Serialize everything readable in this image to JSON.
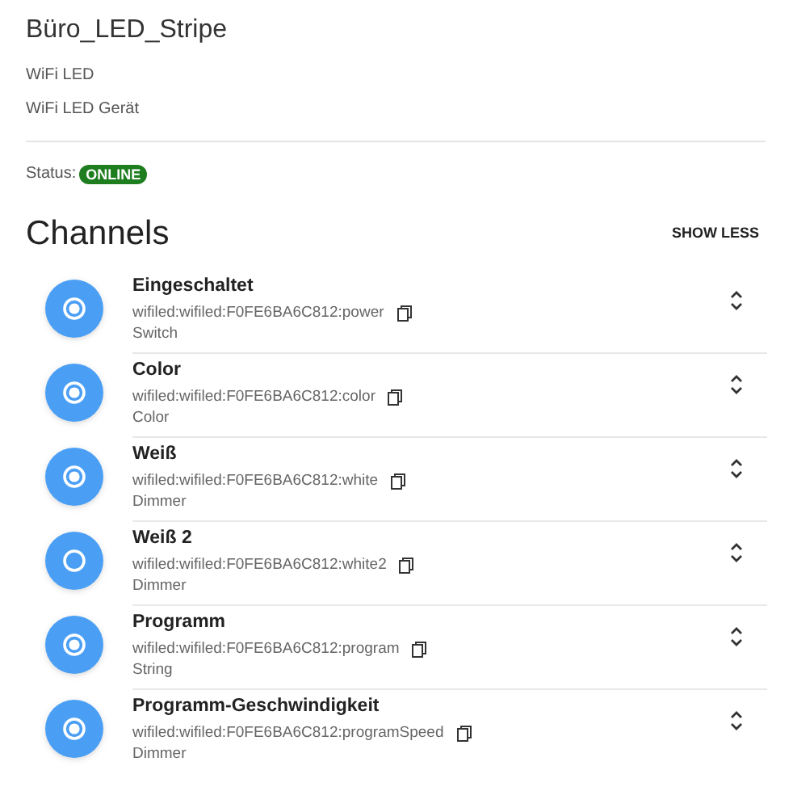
{
  "thing": {
    "title": "Büro_LED_Stripe",
    "type": "WiFi LED",
    "description": "WiFi LED Gerät"
  },
  "status": {
    "label": "Status:",
    "badge": "ONLINE"
  },
  "channels_section": {
    "title": "Channels",
    "toggle": "SHOW LESS"
  },
  "channels": [
    {
      "name": "Eingeschaltet",
      "uid": "wifiled:wifiled:F0FE6BA6C812:power",
      "type": "Switch",
      "linked": true
    },
    {
      "name": "Color",
      "uid": "wifiled:wifiled:F0FE6BA6C812:color",
      "type": "Color",
      "linked": true
    },
    {
      "name": "Weiß",
      "uid": "wifiled:wifiled:F0FE6BA6C812:white",
      "type": "Dimmer",
      "linked": true
    },
    {
      "name": "Weiß 2",
      "uid": "wifiled:wifiled:F0FE6BA6C812:white2",
      "type": "Dimmer",
      "linked": false
    },
    {
      "name": "Programm",
      "uid": "wifiled:wifiled:F0FE6BA6C812:program",
      "type": "String",
      "linked": true
    },
    {
      "name": "Programm-Geschwindigkeit",
      "uid": "wifiled:wifiled:F0FE6BA6C812:programSpeed",
      "type": "Dimmer",
      "linked": true
    }
  ]
}
